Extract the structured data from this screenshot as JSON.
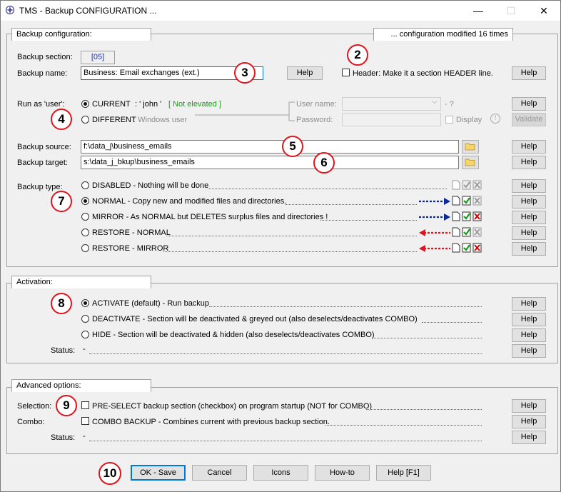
{
  "window": {
    "title": "TMS - Backup CONFIGURATION ...",
    "minimize": "—",
    "maximize": "☐",
    "close": "✕"
  },
  "backup_config": {
    "group_title": "Backup configuration:",
    "modified_note": "... configuration modified 16 times",
    "section_label": "Backup section:",
    "section_value": "[05]",
    "name_label": "Backup name:",
    "name_value": "Business: Email exchanges (ext.)",
    "help": "Help",
    "header_label": "Header: Make it a section HEADER line.",
    "run_as_label": "Run as 'user':",
    "current_label": "CURRENT",
    "current_user": ": ' john '",
    "not_elevated": "[ Not elevated ]",
    "different_label": "DIFFERENT",
    "different_desc": ": Windows user",
    "username_label": "User name:",
    "username_suffix": "- ?",
    "password_label": "Password:",
    "display_label": "Display",
    "info_icon": "!",
    "validate": "Validate",
    "source_label": "Backup source:",
    "source_value": "f:\\data_j\\business_emails",
    "target_label": "Backup target:",
    "target_value": "s:\\data_j_bkup\\business_emails",
    "type_label": "Backup type:",
    "types": [
      {
        "label": "DISABLED - Nothing will be done"
      },
      {
        "label": "NORMAL - Copy new and modified files and directories."
      },
      {
        "label": "MIRROR - As NORMAL but DELETES surplus files and directories !"
      },
      {
        "label": "RESTORE - NORMAL"
      },
      {
        "label": "RESTORE - MIRROR"
      }
    ]
  },
  "activation": {
    "group_title": "Activation:",
    "options": [
      {
        "label": "ACTIVATE (default) - Run backup"
      },
      {
        "label": "DEACTIVATE - Section will be deactivated & greyed out (also deselects/deactivates COMBO)"
      },
      {
        "label": "HIDE - Section will be deactivated & hidden (also deselects/deactivates COMBO)"
      }
    ],
    "status_label": "Status:",
    "status_value": "-"
  },
  "advanced": {
    "group_title": "Advanced options:",
    "selection_label": "Selection:",
    "selection_text": "PRE-SELECT backup section (checkbox) on program startup (NOT for COMBO)",
    "combo_label": "Combo:",
    "combo_text": "COMBO BACKUP - Combines current with previous backup section.",
    "status_label": "Status:",
    "status_value": "-"
  },
  "footer": {
    "ok": "OK - Save",
    "cancel": "Cancel",
    "icons": "Icons",
    "howto": "How-to",
    "help": "Help [F1]"
  },
  "markers": [
    "2",
    "3",
    "4",
    "5",
    "6",
    "7",
    "8",
    "9",
    "10"
  ],
  "colors": {
    "marker_red": "#e0141c",
    "arrow_blue": "#0a2a9c",
    "arrow_red": "#e0141c",
    "check_green": "#1a9a1a",
    "x_red": "#d00000"
  }
}
